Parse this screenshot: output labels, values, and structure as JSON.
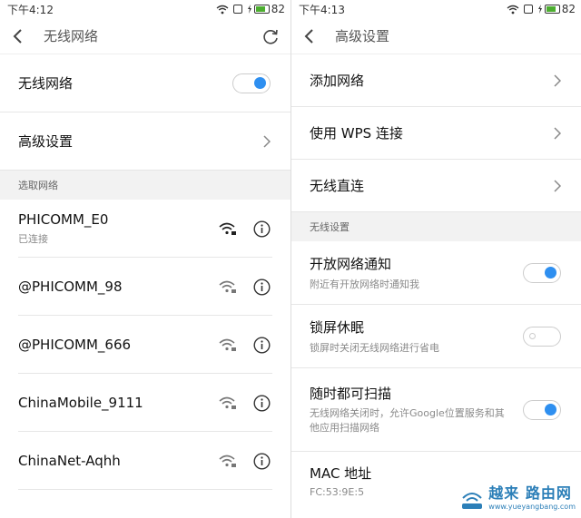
{
  "left": {
    "status": {
      "time": "下午4:12",
      "battery": "82"
    },
    "title": "无线网络",
    "wifi_toggle": {
      "label": "无线网络",
      "on": true
    },
    "advanced": {
      "label": "高级设置"
    },
    "section_networks": "选取网络",
    "networks": [
      {
        "name": "PHICOMM_E0",
        "status": "已连接"
      },
      {
        "name": "@PHICOMM_98",
        "status": ""
      },
      {
        "name": "@PHICOMM_666",
        "status": ""
      },
      {
        "name": "ChinaMobile_9111",
        "status": ""
      },
      {
        "name": "ChinaNet-Aqhh",
        "status": ""
      }
    ]
  },
  "right": {
    "status": {
      "time": "下午4:13",
      "battery": "82"
    },
    "title": "高级设置",
    "items": [
      {
        "label": "添加网络"
      },
      {
        "label": "使用 WPS 连接"
      },
      {
        "label": "无线直连"
      }
    ],
    "section_wireless": "无线设置",
    "toggles": [
      {
        "label": "开放网络通知",
        "desc": "附近有开放网络时通知我",
        "on": true
      },
      {
        "label": "锁屏休眠",
        "desc": "锁屏时关闭无线网络进行省电",
        "on": false
      },
      {
        "label": "随时都可扫描",
        "desc": "无线网络关闭时，允许Google位置服务和其他应用扫描网络",
        "on": true
      }
    ],
    "mac": {
      "label": "MAC 地址",
      "value": "FC:53:9E:5"
    }
  },
  "watermark": {
    "brand": "越来 路由网",
    "url": "www.yueyangbang.com"
  },
  "colors": {
    "accent": "#2e8ff0",
    "battery": "#4cae2f"
  }
}
